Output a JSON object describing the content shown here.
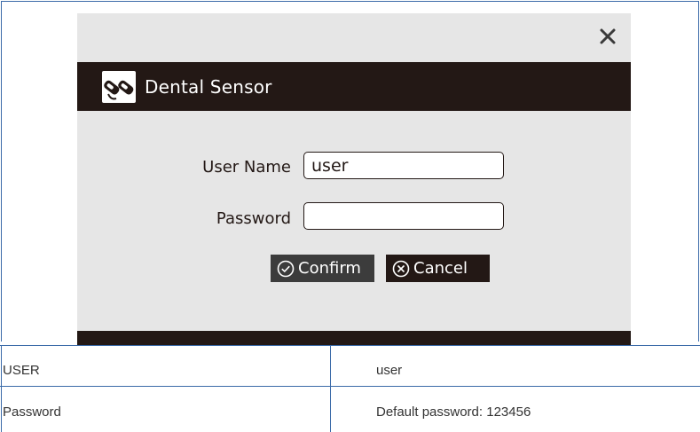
{
  "dialog": {
    "close_symbol": "✕",
    "title": "Dental Sensor",
    "user_label": "User Name",
    "user_value": "user",
    "password_label": "Password",
    "password_value": "",
    "confirm_label": "Confirm",
    "cancel_label": "Cancel"
  },
  "table": {
    "rows": [
      {
        "key": "USER",
        "value": "user"
      },
      {
        "key": "Password",
        "value": "Default password: 123456"
      }
    ]
  },
  "colors": {
    "dialog_bg": "#e6e6e6",
    "title_bar": "#231815",
    "frame_border": "#3a6aa8"
  },
  "icons": [
    "close-icon",
    "dental-sensor-logo",
    "check-circle-icon",
    "x-circle-icon"
  ]
}
